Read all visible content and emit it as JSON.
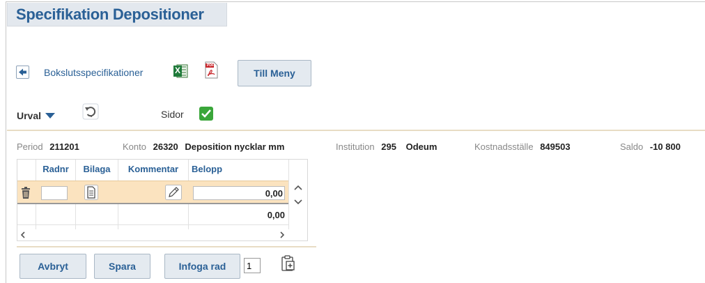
{
  "page": {
    "title": "Specifikation Depositioner"
  },
  "nav": {
    "back_link": "Bokslutsspecifikationer",
    "menu_button": "Till Meny",
    "excel_icon_letters": "X",
    "pdf_icon_letters": "PDF"
  },
  "filter": {
    "urval_label": "Urval",
    "sidor_label": "Sidor"
  },
  "info": {
    "period_label": "Period",
    "period_value": "211201",
    "konto_label": "Konto",
    "konto_value": "26320",
    "konto_name": "Deposition nycklar mm",
    "institution_label": "Institution",
    "institution_value": "295",
    "institution_name": "Odeum",
    "kostnadsstalle_label": "Kostnadsställe",
    "kostnadsstalle_value": "849503",
    "saldo_label": "Saldo",
    "saldo_value": "-10 800"
  },
  "table": {
    "headers": {
      "radnr": "Radnr",
      "bilaga": "Bilaga",
      "kommentar": "Kommentar",
      "belopp": "Belopp"
    },
    "row": {
      "belopp": "0,00"
    },
    "total": "0,00"
  },
  "actions": {
    "cancel": "Avbryt",
    "save": "Spara",
    "insert_row": "Infoga rad",
    "insert_count": "1"
  },
  "colors": {
    "accent": "#2a6096",
    "row_highlight": "#fbe3bf",
    "divider": "#e8dcc4",
    "check_green": "#3aa63a"
  }
}
